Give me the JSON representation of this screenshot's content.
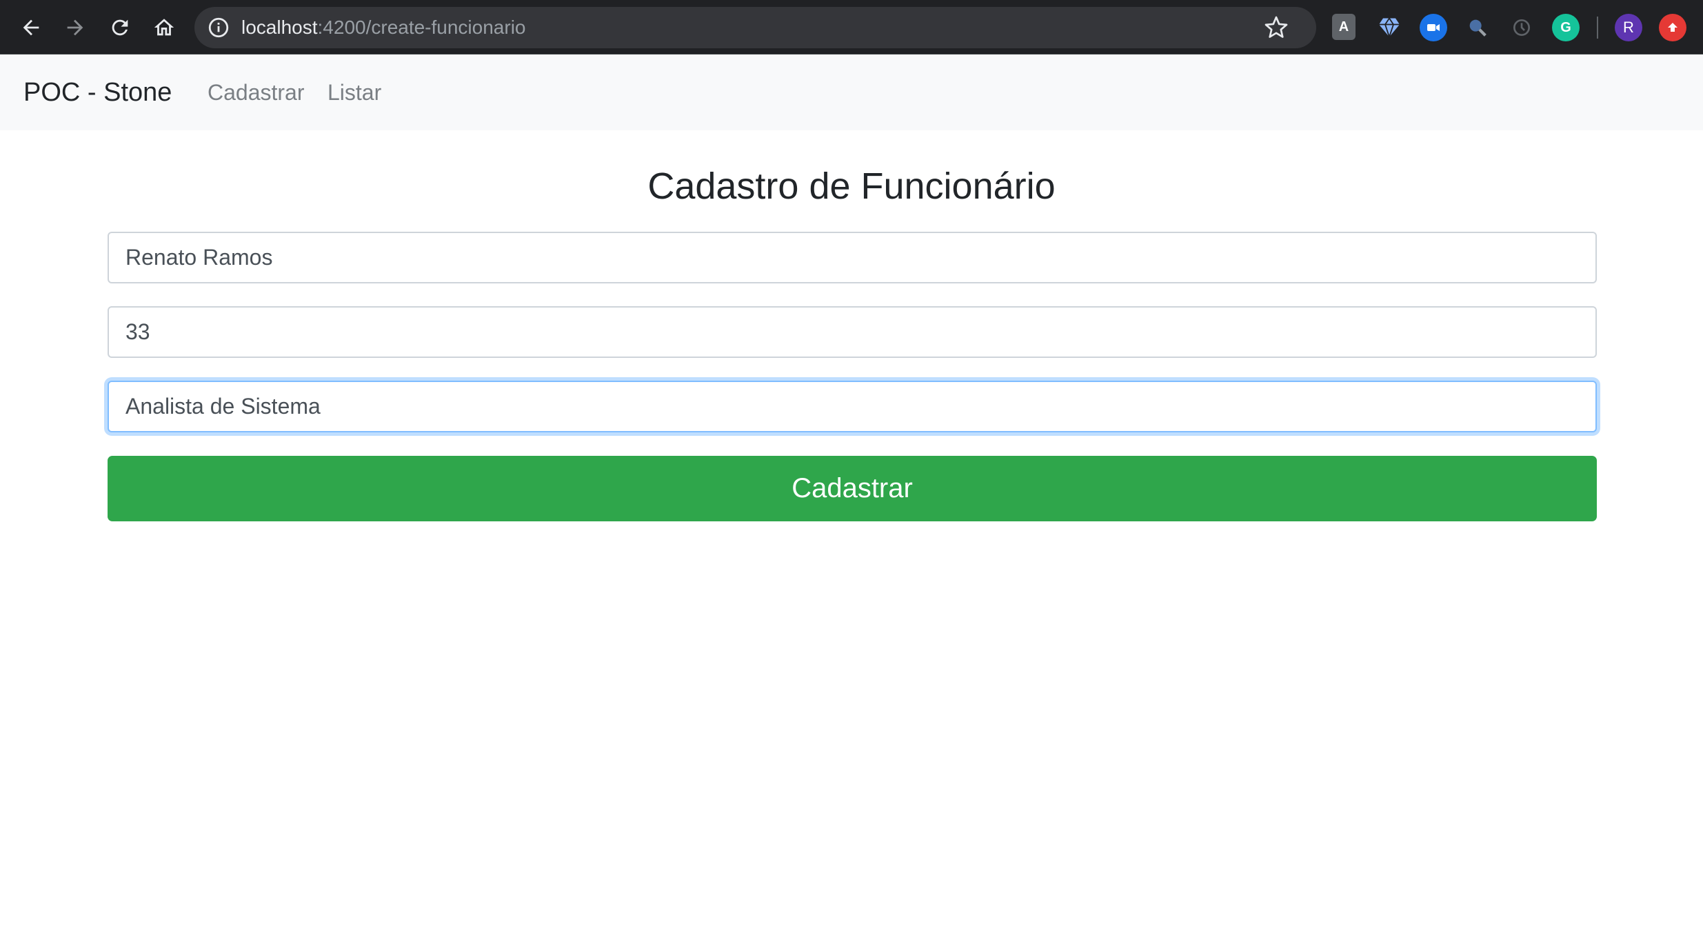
{
  "browser": {
    "url_host": "localhost",
    "url_path": ":4200/create-funcionario",
    "profile_initial": "R",
    "extensions": [
      {
        "name": "angular-extension-icon",
        "color": "#5f6368",
        "glyph": "A"
      },
      {
        "name": "gem-extension-icon",
        "color": "#8ab4f8",
        "glyph": ""
      },
      {
        "name": "video-extension-icon",
        "color": "#1a73e8",
        "glyph": ""
      },
      {
        "name": "search-extension-icon",
        "color": "#4a6fa5",
        "glyph": ""
      },
      {
        "name": "sync-extension-icon",
        "color": "#5f6368",
        "glyph": ""
      },
      {
        "name": "grammarly-extension-icon",
        "color": "#15c39a",
        "glyph": "G"
      }
    ]
  },
  "navbar": {
    "brand": "POC - Stone",
    "links": [
      "Cadastrar",
      "Listar"
    ]
  },
  "form": {
    "title": "Cadastro de Funcionário",
    "fields": [
      {
        "value": "Renato Ramos"
      },
      {
        "value": "33"
      },
      {
        "value": "Analista de Sistema"
      }
    ],
    "submit_label": "Cadastrar",
    "submit_color": "#2fa64b"
  }
}
